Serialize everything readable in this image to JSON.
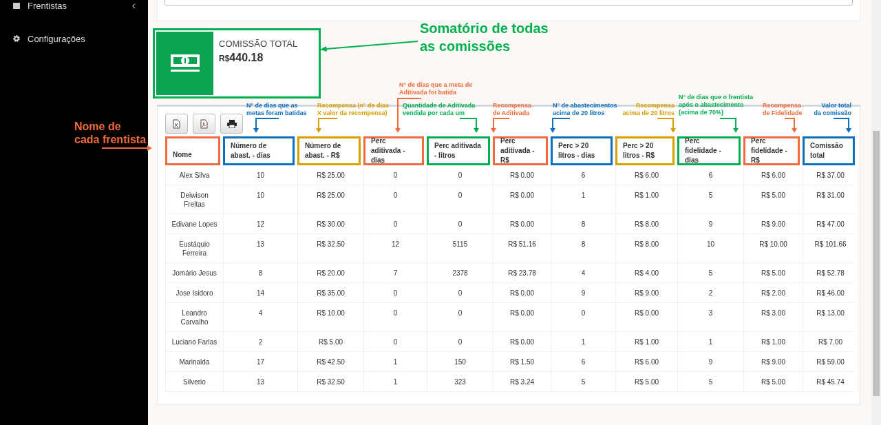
{
  "sidebar": {
    "items": [
      {
        "label": "Frentistas",
        "chevron": "‹"
      },
      {
        "label": "Configurações"
      }
    ]
  },
  "summary": {
    "title": "COMISSÃO TOTAL",
    "currency": "R$",
    "amount": "440.18",
    "annotation": {
      "lines": [
        "Somatório de todas",
        "as comissões"
      ],
      "color": "#00b050"
    }
  },
  "table": {
    "columns": [
      {
        "label": "Nome",
        "color": "#f26b3a",
        "annotation": [
          "Nome de",
          "cada frentista"
        ]
      },
      {
        "label": "Número de abast. - dias",
        "color": "#0b6fc2",
        "annotation": [
          "N° de dias que as",
          "metas foram batidas"
        ]
      },
      {
        "label": "Número de abast. - R$",
        "color": "#d99e00",
        "annotation": [
          "Recompensa (n° de dias",
          "X valor da recompensa)"
        ]
      },
      {
        "label": "Perc aditivada - dias",
        "color": "#f26b3a",
        "annotation": [
          "N° de dias que a meta de",
          "Aditivada foi batida"
        ]
      },
      {
        "label": "Perc aditivada - litros",
        "color": "#00b050",
        "annotation": [
          "Quantidade de Aditivada",
          "vendida por cada um"
        ]
      },
      {
        "label": "Perc aditivada - R$",
        "color": "#f26b3a",
        "annotation": [
          "Recompensa",
          "de Aditivada"
        ]
      },
      {
        "label": "Perc > 20 litros - dias",
        "color": "#0b6fc2",
        "annotation": [
          "N° de abastecimentos",
          "acima de 20 litros"
        ]
      },
      {
        "label": "Perc > 20 litros - R$",
        "color": "#d99e00",
        "annotation": [
          "Recompensa",
          "acima de 20 litros"
        ]
      },
      {
        "label": "Perc fidelidade - dias",
        "color": "#00b050",
        "annotation": [
          "N° de dias que o frentista",
          "após o abastecimento",
          "(acima de 70%)"
        ]
      },
      {
        "label": "Perc fidelidade - R$",
        "color": "#f26b3a",
        "annotation": [
          "Recompensa",
          "de Fidelidade"
        ]
      },
      {
        "label": "Comissão total",
        "color": "#0b6fc2",
        "annotation": [
          "Valor total",
          "da comissão"
        ]
      }
    ],
    "rows": [
      [
        "Alex Silva",
        "10",
        "R$ 25.00",
        "0",
        "0",
        "R$ 0.00",
        "6",
        "R$ 6.00",
        "6",
        "R$ 6.00",
        "R$ 37.00"
      ],
      [
        "Deiwison Freitas",
        "10",
        "R$ 25.00",
        "0",
        "0",
        "R$ 0.00",
        "1",
        "R$ 1.00",
        "5",
        "R$ 5.00",
        "R$ 31.00"
      ],
      [
        "Edivane Lopes",
        "12",
        "R$ 30.00",
        "0",
        "0",
        "R$ 0.00",
        "8",
        "R$ 8.00",
        "9",
        "R$ 9.00",
        "R$ 47.00"
      ],
      [
        "Eustáquio Ferreira",
        "13",
        "R$ 32.50",
        "12",
        "5115",
        "R$ 51.16",
        "8",
        "R$ 8.00",
        "10",
        "R$ 10.00",
        "R$ 101.66"
      ],
      [
        "Jomário Jesus",
        "8",
        "R$ 20.00",
        "7",
        "2378",
        "R$ 23.78",
        "4",
        "R$ 4.00",
        "5",
        "R$ 5.00",
        "R$ 52.78"
      ],
      [
        "Jose Isidoro",
        "14",
        "R$ 35.00",
        "0",
        "0",
        "R$ 0.00",
        "9",
        "R$ 9.00",
        "2",
        "R$ 2.00",
        "R$ 46.00"
      ],
      [
        "Leandro Carvalho",
        "4",
        "R$ 10.00",
        "0",
        "0",
        "R$ 0.00",
        "0",
        "R$ 0.00",
        "3",
        "R$ 3.00",
        "R$ 13.00"
      ],
      [
        "Luciano Farias",
        "2",
        "R$ 5.00",
        "0",
        "0",
        "R$ 0.00",
        "1",
        "R$ 1.00",
        "1",
        "R$ 1.00",
        "R$ 7.00"
      ],
      [
        "Marinalda",
        "17",
        "R$ 42.50",
        "1",
        "150",
        "R$ 1.50",
        "6",
        "R$ 6.00",
        "9",
        "R$ 9.00",
        "R$ 59.00"
      ],
      [
        "Silverio",
        "13",
        "R$ 32.50",
        "1",
        "323",
        "R$ 3.24",
        "5",
        "R$ 5.00",
        "5",
        "R$ 5.00",
        "R$ 45.74"
      ]
    ]
  }
}
